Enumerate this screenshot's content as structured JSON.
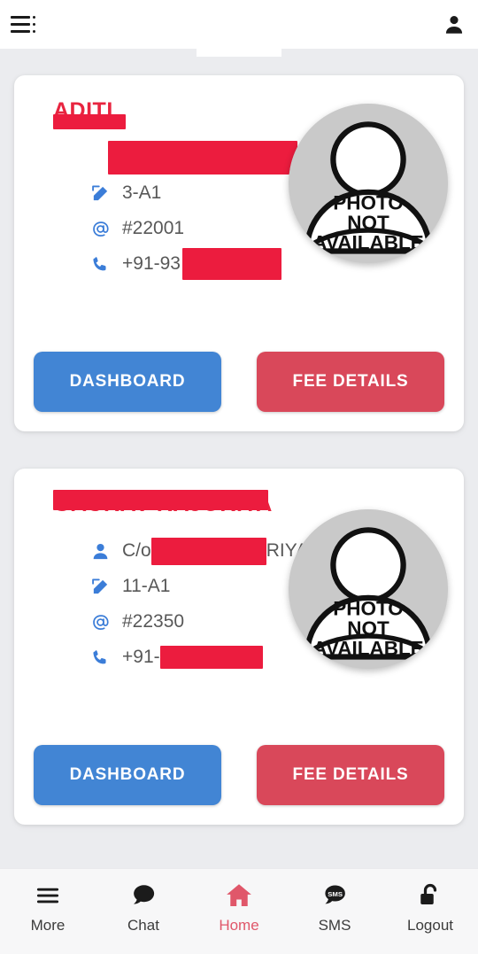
{
  "header": {
    "menu_icon": "list-menu-icon",
    "profile_icon": "person-icon"
  },
  "students": [
    {
      "name": "ADITI",
      "name_redacted": true,
      "guardian_line": null,
      "guardian_redacted_full": true,
      "class_label": "3-A1",
      "admission_label": "#22001",
      "phone_label": "+91-93",
      "phone_redacted": true,
      "avatar_text_line1": "PHOTO",
      "avatar_text_line2": "NOT",
      "avatar_text_line3": "AVAILABLE",
      "dashboard_label": "DASHBOARD",
      "fee_label": "FEE DETAILS"
    },
    {
      "name": "GAURAV RAJORIYA",
      "name_redacted": true,
      "guardian_prefix": "C/o ",
      "guardian_suffix": "RIYA",
      "guardian_redacted_full": false,
      "class_label": "11-A1",
      "admission_label": "#22350",
      "phone_label": "+91-",
      "phone_redacted": true,
      "avatar_text_line1": "PHOTO",
      "avatar_text_line2": "NOT",
      "avatar_text_line3": "AVAILABLE",
      "dashboard_label": "DASHBOARD",
      "fee_label": "FEE DETAILS"
    }
  ],
  "bottom_nav": {
    "active": "Home",
    "items": [
      {
        "label": "More",
        "icon": "hamburger-icon"
      },
      {
        "label": "Chat",
        "icon": "chat-bubble-icon"
      },
      {
        "label": "Home",
        "icon": "home-icon"
      },
      {
        "label": "SMS",
        "icon": "sms-bubble-icon"
      },
      {
        "label": "Logout",
        "icon": "unlock-icon"
      }
    ]
  },
  "colors": {
    "accent_red": "#e0576a",
    "button_blue": "#4285d4",
    "button_red": "#d9485a",
    "redaction_red": "#ec1c3e",
    "icon_blue": "#3b7dd8",
    "page_bg": "#ebecef"
  }
}
